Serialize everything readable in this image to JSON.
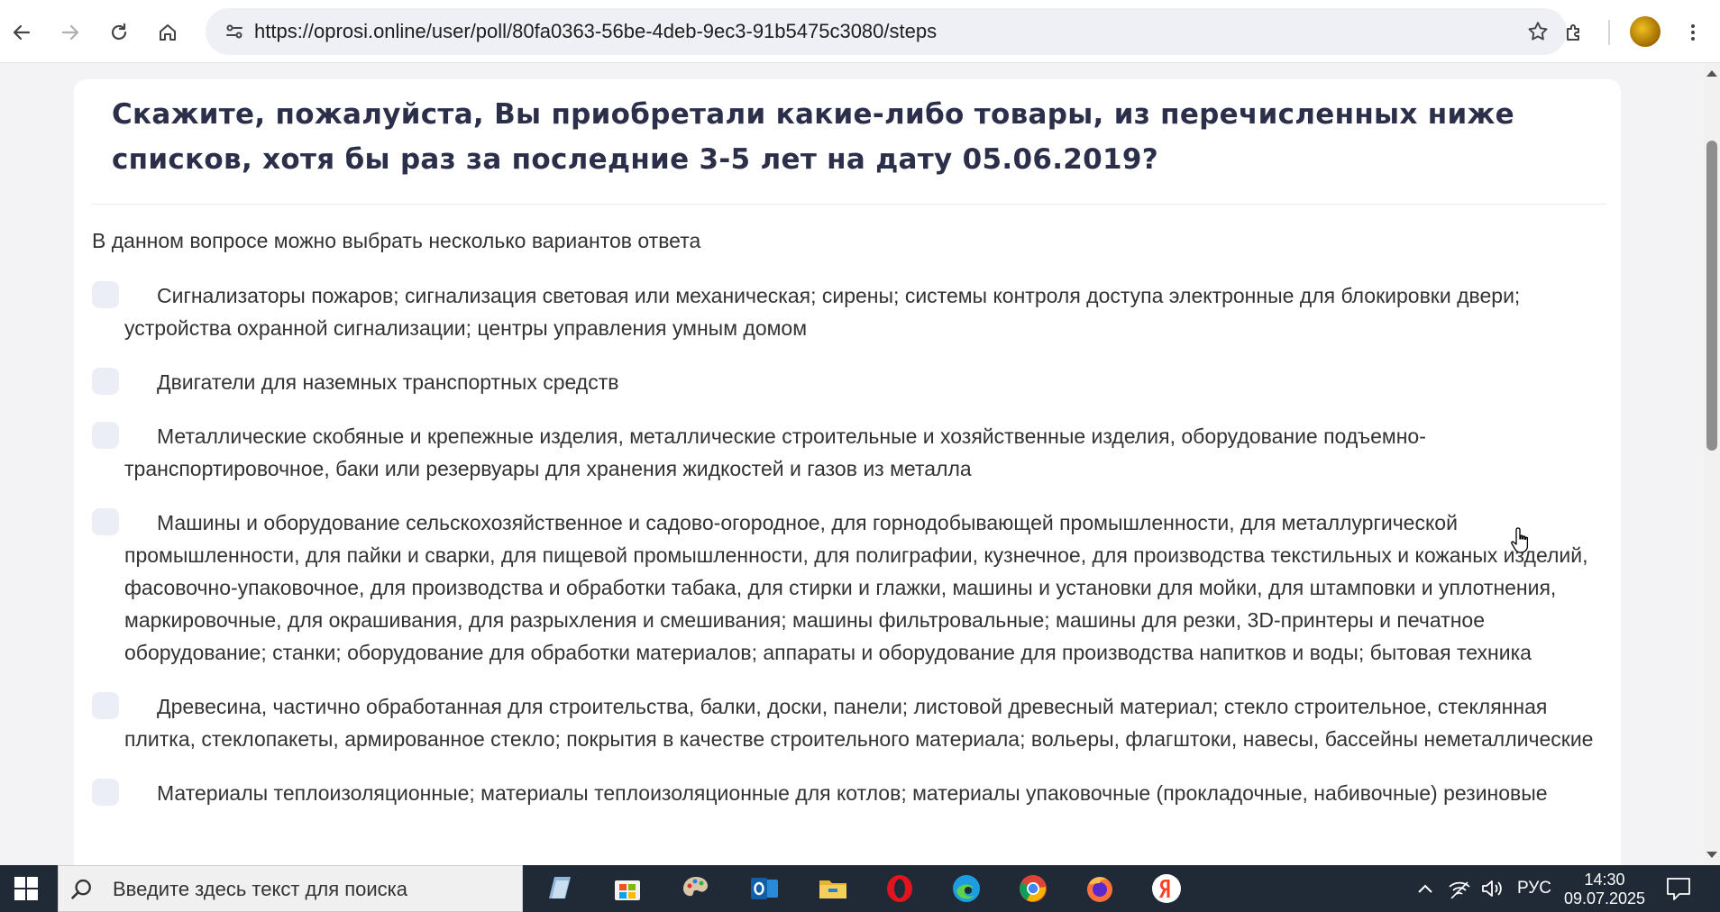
{
  "browser": {
    "url": "https://oprosi.online/user/poll/80fa0363-56be-4deb-9ec3-91b5475c3080/steps",
    "icons": [
      "back-icon",
      "forward-icon",
      "reload-icon",
      "home-icon",
      "site-info-icon",
      "bookmark-star-icon",
      "extensions-icon",
      "profile-avatar",
      "menu-icon"
    ]
  },
  "question": {
    "title": "Скажите, пожалуйста, Вы приобретали какие-либо товары, из перечисленных ниже списков, хотя бы раз за последние 3-5 лет на дату 05.06.2019?",
    "hint": "В данном вопросе можно выбрать несколько вариантов ответа",
    "options": [
      "Сигнализаторы пожаров; сигнализация световая или механическая; сирены; системы контроля доступа электронные для блокировки двери; устройства охранной сигнализации; центры управления умным домом",
      "Двигатели для наземных транспортных средств",
      "Металлические скобяные и крепежные изделия, металлические строительные и хозяйственные изделия, оборудование подъемно-транспортировочное, баки или резервуары для хранения жидкостей и газов из металла",
      "Машины и оборудование сельскохозяйственное и садово-огородное, для горнодобывающей промышленности, для металлургической промышленности, для пайки и сварки, для пищевой промышленности, для полиграфии, кузнечное, для производства текстильных и кожаных изделий, фасовочно-упаковочное, для производства и обработки табака, для стирки и глажки, машины и установки для мойки, для штамповки и уплотнения, маркировочные, для окрашивания, для разрыхления и смешивания; машины фильтровальные; машины для резки, 3D-принтеры и печатное оборудование; станки; оборудование для обработки материалов; аппараты и оборудование для производства напитков и воды; бытовая техника",
      "Древесина, частично обработанная для строительства, балки, доски, панели; листовой древесный материал; стекло строительное, стеклянная плитка, стеклопакеты, армированное стекло; покрытия в качестве строительного материала; вольеры, флагштоки, навесы, бассейны неметаллические",
      "Материалы теплоизоляционные; материалы теплоизоляционные для котлов; материалы упаковочные (прокладочные, набивочные) резиновые"
    ]
  },
  "taskbar": {
    "search_placeholder": "Введите здесь текст для поиска",
    "language": "РУС",
    "time": "14:30",
    "date": "09.07.2025",
    "apps": [
      "notepad-icon",
      "store-icon",
      "paint-icon",
      "outlook-icon",
      "file-explorer-icon",
      "opera-icon",
      "edge-icon",
      "chrome-icon",
      "firefox-icon",
      "yandex-icon"
    ]
  }
}
